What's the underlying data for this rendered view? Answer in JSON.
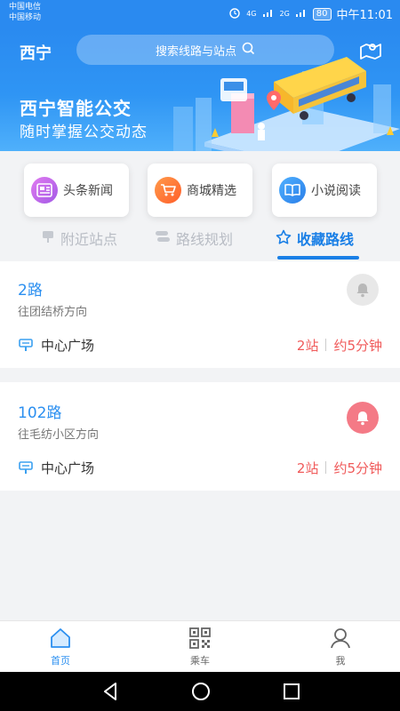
{
  "status_bar": {
    "carrier1": "中国电信",
    "carrier2": "中国移动",
    "net1": "4G",
    "net2": "2G",
    "battery": "80",
    "time": "中午11:01"
  },
  "header": {
    "city": "西宁",
    "search_placeholder": "搜索线路与站点",
    "slogan_line1": "西宁智能公交",
    "slogan_line2": "随时掌握公交动态"
  },
  "quick_links": [
    {
      "label": "头条新闻",
      "icon": "news-icon",
      "color": "#c86ae8"
    },
    {
      "label": "商城精选",
      "icon": "cart-icon",
      "color": "#ff7a3c"
    },
    {
      "label": "小说阅读",
      "icon": "book-icon",
      "color": "#3a9af5"
    }
  ],
  "tabs": [
    {
      "label": "附近站点",
      "icon": "bus-stop-icon",
      "active": false
    },
    {
      "label": "路线规划",
      "icon": "route-icon",
      "active": false
    },
    {
      "label": "收藏路线",
      "icon": "star-icon",
      "active": true
    }
  ],
  "routes": [
    {
      "name": "2路",
      "direction": "往团结桥方向",
      "stop": "中心广场",
      "stops_away": "2站",
      "eta": "约5分钟",
      "reminder": false
    },
    {
      "name": "102路",
      "direction": "往毛纺小区方向",
      "stop": "中心广场",
      "stops_away": "2站",
      "eta": "约5分钟",
      "reminder": true
    }
  ],
  "bottom_nav": [
    {
      "label": "首页",
      "icon": "home-icon",
      "active": true
    },
    {
      "label": "乘车",
      "icon": "qr-code-icon",
      "active": false
    },
    {
      "label": "我",
      "icon": "user-icon",
      "active": false
    }
  ],
  "colors": {
    "primary": "#2a8af0",
    "accent_red": "#f05a5a",
    "bell_active": "#f47a86",
    "bell_inactive": "#e8e8e8"
  }
}
